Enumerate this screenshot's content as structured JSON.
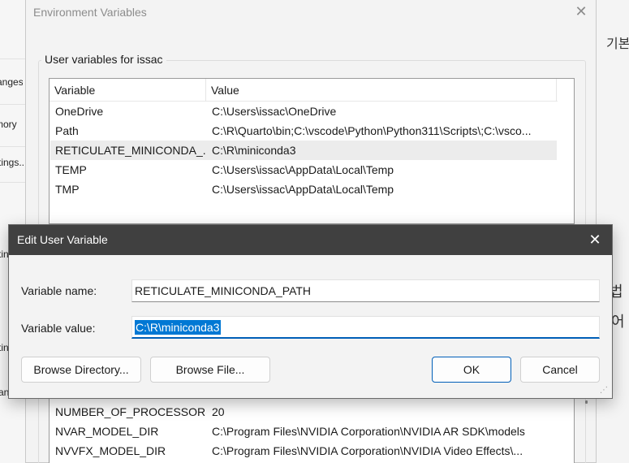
{
  "background_left": {
    "rows": [
      "anges",
      "mory",
      "tings..",
      "tin",
      "tin",
      "an"
    ]
  },
  "background_right": {
    "top_text": "기본",
    "mid_text_1": "법",
    "mid_text_2": "어"
  },
  "env_window": {
    "title": "Environment Variables",
    "close_glyph": "✕",
    "user_group_label": "User variables for issac",
    "user_list": {
      "columns": [
        "Variable",
        "Value"
      ],
      "rows": [
        {
          "name": "OneDrive",
          "value": "C:\\Users\\issac\\OneDrive"
        },
        {
          "name": "Path",
          "value": "C:\\R\\Quarto\\bin;C:\\vscode\\Python\\Python311\\Scripts\\;C:\\vsco..."
        },
        {
          "name": "RETICULATE_MINICONDA_...",
          "value": "C:\\R\\miniconda3",
          "selected": true
        },
        {
          "name": "TEMP",
          "value": "C:\\Users\\issac\\AppData\\Local\\Temp"
        },
        {
          "name": "TMP",
          "value": "C:\\Users\\issac\\AppData\\Local\\Temp"
        }
      ]
    },
    "system_list": {
      "rows": [
        {
          "name": "NUMBER_OF_PROCESSORS",
          "value": "20"
        },
        {
          "name": "NVAR_MODEL_DIR",
          "value": "C:\\Program Files\\NVIDIA Corporation\\NVIDIA AR SDK\\models"
        },
        {
          "name": "NVVFX_MODEL_DIR",
          "value": "C:\\Program Files\\NVIDIA Corporation\\NVIDIA Video Effects\\..."
        }
      ]
    }
  },
  "edit_dialog": {
    "title": "Edit User Variable",
    "close_glyph": "✕",
    "variable_name_label": "Variable name:",
    "variable_name_value": "RETICULATE_MINICONDA_PATH",
    "variable_value_label": "Variable value:",
    "variable_value_value": "C:\\R\\miniconda3",
    "browse_directory_label": "Browse Directory...",
    "browse_file_label": "Browse File...",
    "ok_label": "OK",
    "cancel_label": "Cancel",
    "resize_glyph": "⋰"
  },
  "colors": {
    "accent": "#005fb8",
    "selection": "#0078d4",
    "titlebar_dark": "#404040"
  }
}
